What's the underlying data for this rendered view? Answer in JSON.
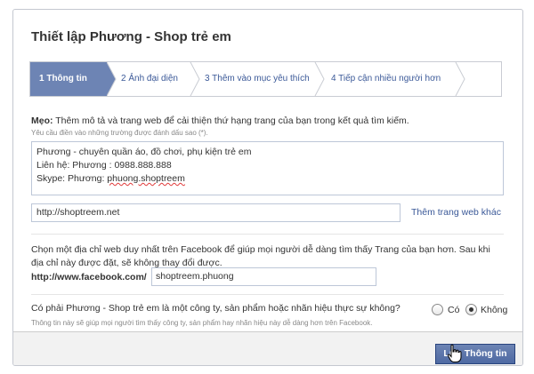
{
  "page_title": "Thiết lập Phương - Shop trẻ em",
  "steps": [
    {
      "label": "1 Thông tin"
    },
    {
      "label": "2 Ảnh đại diện"
    },
    {
      "label": "3 Thêm vào mục yêu thích"
    },
    {
      "label": "4 Tiếp cận nhiều người hơn"
    }
  ],
  "tip": {
    "prefix": "Mẹo:",
    "text": " Thêm mô tả và trang web để cải thiện thứ hạng trang của bạn trong kết quả tìm kiếm.",
    "required_note": "Yêu cầu điền vào những trường được đánh dấu sao (*)."
  },
  "description": {
    "line1": "Phương - chuyên quần áo, đồ chơi, phụ kiện trẻ em",
    "line2": "Liên hệ: Phương : 0988.888.888",
    "line3_prefix": "Skype: Phương: ",
    "line3_handle": "phuong.shoptreem"
  },
  "website": {
    "value": "http://shoptreem.net",
    "add_link": "Thêm trang web khác"
  },
  "address": {
    "description": "Chọn một địa chỉ web duy nhất trên Facebook để giúp mọi người dễ dàng tìm thấy Trang của bạn hơn. Sau khi địa chỉ này được đặt, sẽ không thay đổi được.",
    "prefix": "http://www.facebook.com/",
    "value": "shoptreem.phuong"
  },
  "business": {
    "question": "Có phải Phương - Shop trẻ em là một công ty, sản phẩm hoặc nhãn hiệu thực sự không?",
    "hint": "Thông tin này sẽ giúp mọi người tìm thấy công ty, sản phẩm hay nhãn hiệu này dễ dàng hơn trên Facebook.",
    "yes_label": "Có",
    "no_label": "Không",
    "selected": "Không"
  },
  "save_label": "Lưu Thông tin",
  "colors": {
    "accent": "#3b5998",
    "active_step": "#6d84b4",
    "button": "#5b74a8"
  }
}
